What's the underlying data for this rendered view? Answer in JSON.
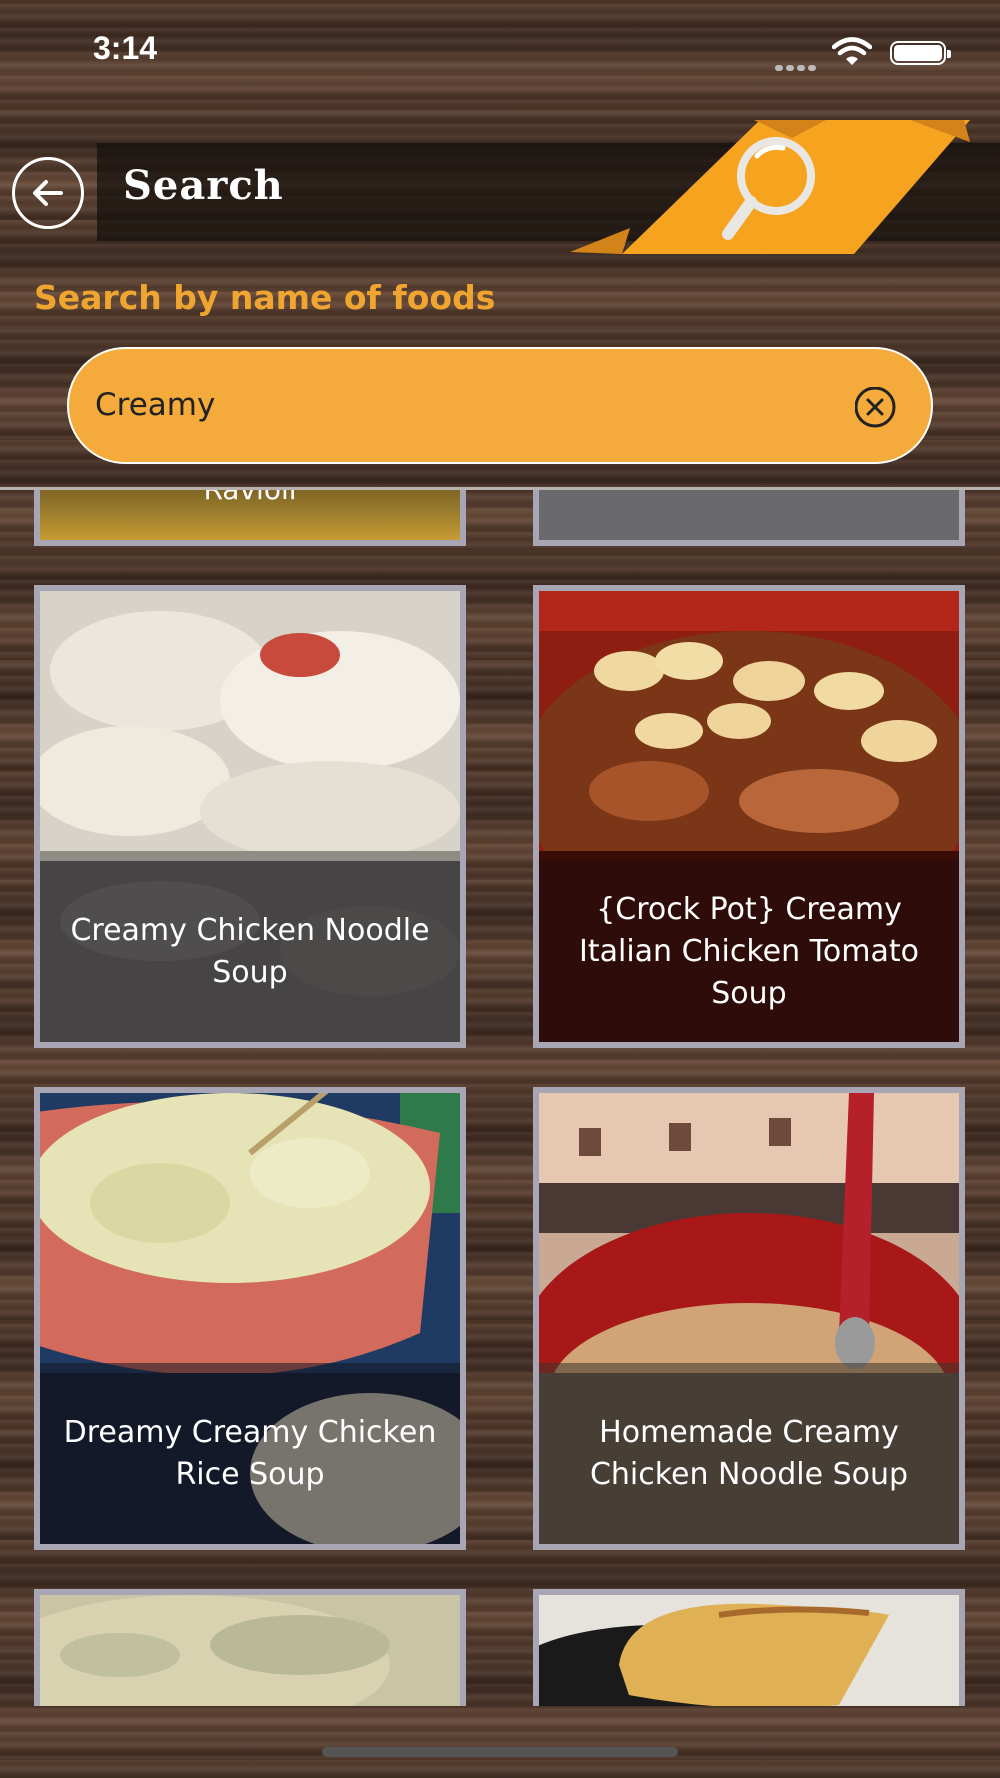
{
  "status": {
    "time": "3:14"
  },
  "header": {
    "title": "Search"
  },
  "search": {
    "label": "Search by name of foods",
    "value": "Creamy"
  },
  "results": [
    {
      "title": "Ravioli"
    },
    {
      "title": ""
    },
    {
      "title": "Creamy Chicken Noodle Soup"
    },
    {
      "title": "{Crock Pot} Creamy Italian Chicken Tomato Soup"
    },
    {
      "title": "Dreamy Creamy Chicken  Rice Soup"
    },
    {
      "title": "Homemade Creamy Chicken Noodle Soup"
    }
  ],
  "colors": {
    "accent": "#f5ab3b",
    "card_border": "#a8a6b4"
  },
  "icons": [
    "back-arrow-icon",
    "magnifier-icon",
    "clear-icon",
    "wifi-icon",
    "battery-icon",
    "signal-icon"
  ]
}
